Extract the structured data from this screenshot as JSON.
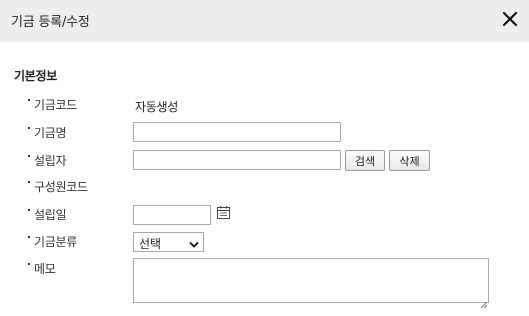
{
  "dialog": {
    "title": "기금 등록/수정",
    "close_icon": "close-icon"
  },
  "section": {
    "title": "기본정보"
  },
  "fields": {
    "fund_code": {
      "label": "기금코드",
      "value": "자동생성"
    },
    "fund_name": {
      "label": "기금명",
      "value": ""
    },
    "founder": {
      "label": "설립자",
      "value": "",
      "search_label": "검색",
      "delete_label": "삭제"
    },
    "member_code": {
      "label": "구성원코드"
    },
    "founded_date": {
      "label": "설립일",
      "value": "",
      "icon": "calendar-icon"
    },
    "category": {
      "label": "기금분류",
      "selected": "선택",
      "icon": "chevron-down-icon"
    },
    "memo": {
      "label": "메모",
      "value": ""
    }
  }
}
